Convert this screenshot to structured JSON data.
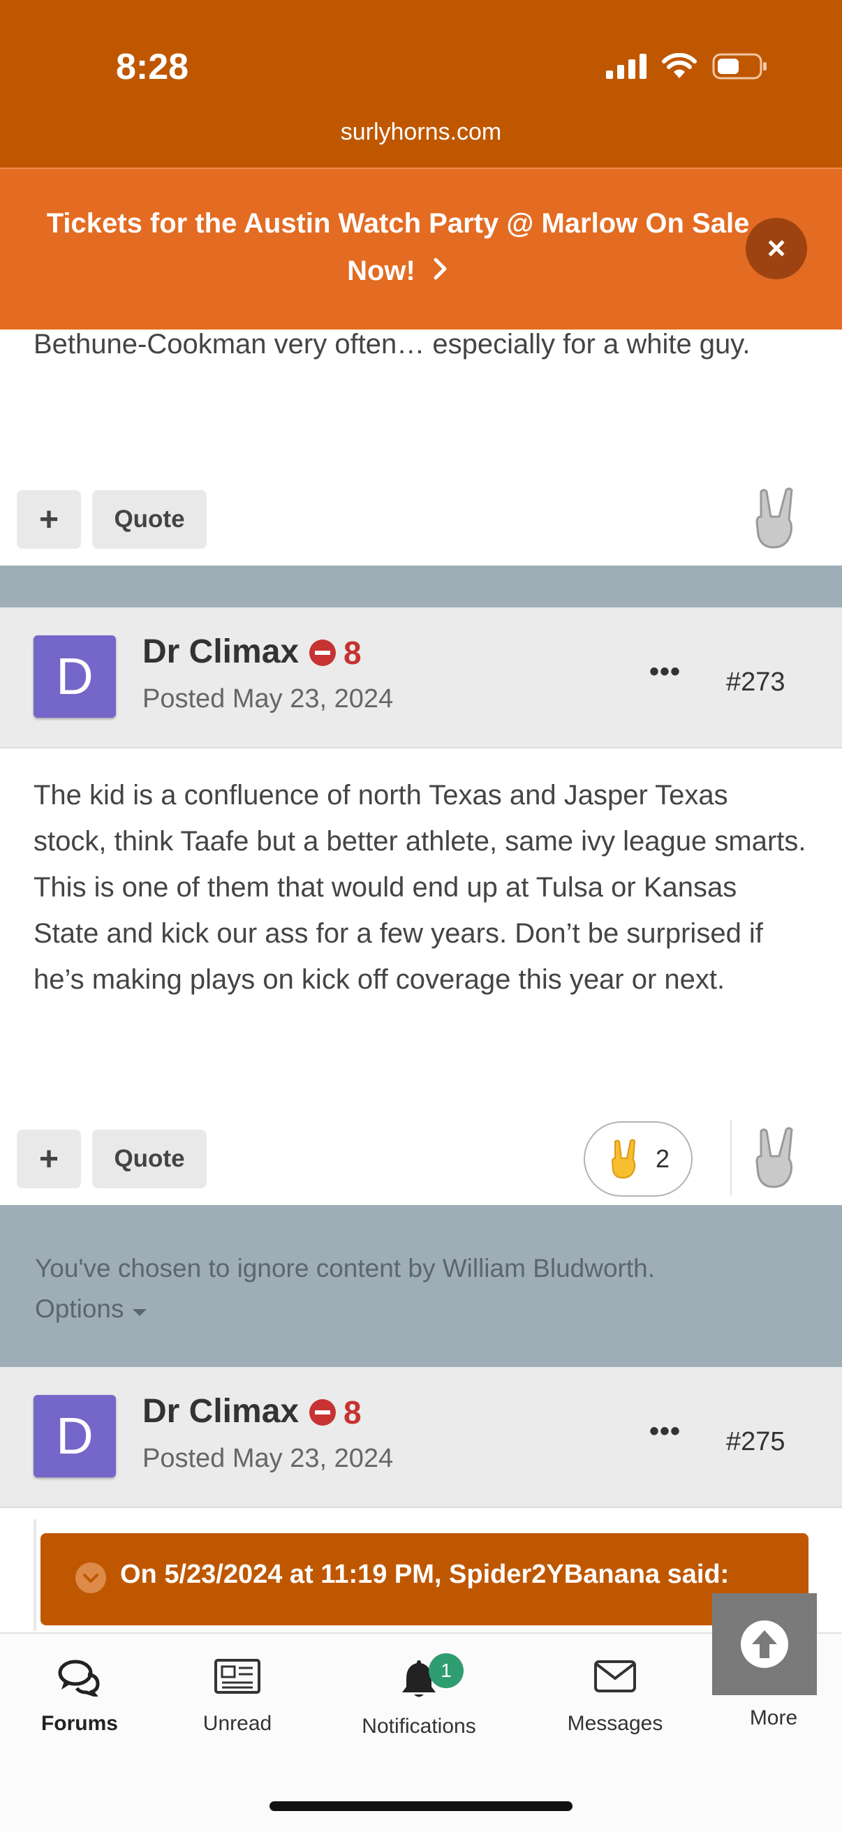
{
  "status_bar": {
    "time": "8:28",
    "url": "surlyhorns.com"
  },
  "announcement": {
    "text": "Tickets for the Austin Watch Party @ Marlow On Sale Now!",
    "close_label": "×"
  },
  "previous_post": {
    "text": "Bethune-Cookman very often… especially for a white guy.",
    "add_label": "+",
    "quote_label": "Quote"
  },
  "posts": [
    {
      "avatar_letter": "D",
      "author": "Dr Climax",
      "reputation": "8",
      "posted": "Posted May 23, 2024",
      "more_label": "•••",
      "number": "#273",
      "body": "The kid is a confluence of north Texas and Jasper Texas stock, think Taafe but a better athlete, same ivy league smarts. This is one of them that would end up at Tulsa or Kansas State and kick our ass for a few years. Don’t be surprised if he’s making plays on kick off coverage this year or next.",
      "add_label": "+",
      "quote_label": "Quote",
      "reaction_count": "2"
    },
    {
      "avatar_letter": "D",
      "author": "Dr Climax",
      "reputation": "8",
      "posted": "Posted May 23, 2024",
      "more_label": "•••",
      "number": "#275",
      "quote_header": "On 5/23/2024 at 11:19 PM, Spider2YBanana said:"
    }
  ],
  "ignored_notice": {
    "text": "You've chosen to ignore content by William Bludworth.",
    "options_label": "Options"
  },
  "tab_bar": {
    "items": [
      {
        "label": "Forums",
        "icon": "forums-icon",
        "active": true
      },
      {
        "label": "Unread",
        "icon": "newspaper-icon"
      },
      {
        "label": "Notifications",
        "icon": "bell-icon",
        "badge": "1"
      },
      {
        "label": "Messages",
        "icon": "envelope-icon"
      },
      {
        "label": "More",
        "icon": "more-icon"
      }
    ]
  },
  "colors": {
    "brand": "#bf5700",
    "announcement": "#e36b22",
    "separator": "#9eadb6",
    "avatar": "#7566c9",
    "reputation": "#c73232",
    "badge": "#2e9d6f"
  }
}
